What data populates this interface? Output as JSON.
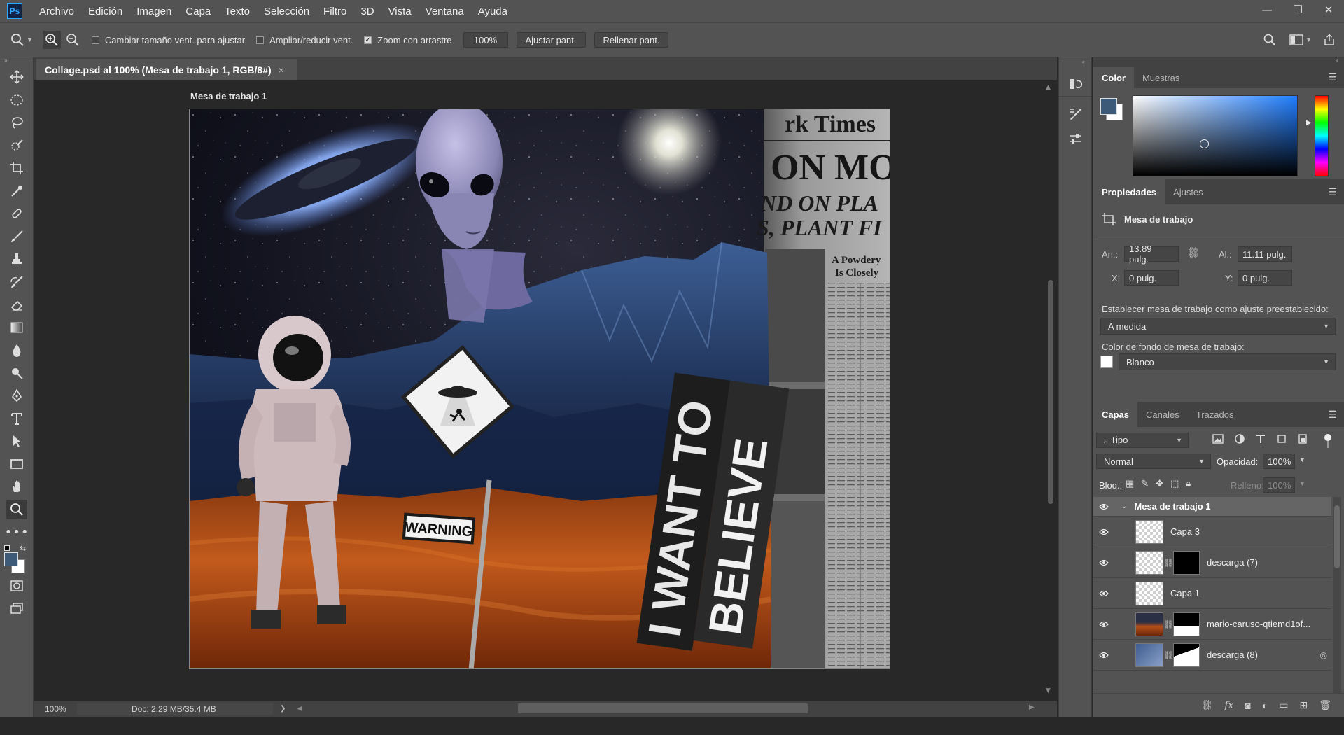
{
  "menu": {
    "logo": "Ps",
    "items": [
      "Archivo",
      "Edición",
      "Imagen",
      "Capa",
      "Texto",
      "Selección",
      "Filtro",
      "3D",
      "Vista",
      "Ventana",
      "Ayuda"
    ]
  },
  "window_controls": {
    "minimize": "—",
    "restore": "❐",
    "close": "✕"
  },
  "options_bar": {
    "resize_windows_label": "Cambiar tamaño vent. para ajustar",
    "resize_windows_checked": false,
    "zoom_all_label": "Ampliar/reducir vent.",
    "zoom_all_checked": false,
    "scrubby_zoom_label": "Zoom con arrastre",
    "scrubby_zoom_checked": true,
    "zoom_value": "100%",
    "fit_screen_label": "Ajustar pant.",
    "fill_screen_label": "Rellenar pant."
  },
  "document": {
    "tab_title": "Collage.psd al 100% (Mesa de trabajo 1, RGB/8#)",
    "tab_close": "×",
    "artboard_label": "Mesa de trabajo 1",
    "collage_texts": {
      "newspaper_masthead": "rk Times",
      "newspaper_headline": "ON MOO",
      "newspaper_sub1": "ND ON PLA",
      "newspaper_sub2": "S, PLANT FI",
      "newspaper_small1": "A Powdery",
      "newspaper_small2": "Is Closely",
      "warning_sign": "WARNING",
      "slogan_line1": "I WANT TO",
      "slogan_line2": "BELIEVE"
    }
  },
  "status_bar": {
    "zoom": "100%",
    "doc_info": "Doc: 2.29 MB/35.4 MB",
    "arrow": "❯"
  },
  "color_panel": {
    "tabs": [
      "Color",
      "Muestras"
    ],
    "active_tab": "Color",
    "foreground_color": "#3d5a78",
    "background_color": "#ffffff"
  },
  "properties_panel": {
    "tabs": [
      "Propiedades",
      "Ajustes"
    ],
    "active_tab": "Propiedades",
    "section_title": "Mesa de trabajo",
    "width_label": "An.:",
    "width_value": "13.89 pulg.",
    "height_label": "Al.:",
    "height_value": "11.11 pulg.",
    "x_label": "X:",
    "x_value": "0 pulg.",
    "y_label": "Y:",
    "y_value": "0 pulg.",
    "preset_label": "Establecer mesa de trabajo como ajuste preestablecido:",
    "preset_value": "A medida",
    "bg_label": "Color de fondo de mesa de trabajo:",
    "bg_value": "Blanco"
  },
  "layers_panel": {
    "tabs": [
      "Capas",
      "Canales",
      "Trazados"
    ],
    "active_tab": "Capas",
    "filter_kind": "Tipo",
    "blend_mode": "Normal",
    "opacity_label": "Opacidad:",
    "opacity_value": "100%",
    "lock_label": "Bloq.:",
    "fill_label": "Relleno:",
    "fill_value": "100%",
    "group_name": "Mesa de trabajo 1",
    "layers": [
      {
        "name": "Capa 3",
        "has_mask": false
      },
      {
        "name": "descarga (7)",
        "has_mask": true
      },
      {
        "name": "Capa 1",
        "has_mask": false
      },
      {
        "name": "mario-caruso-qtiemd1of...",
        "has_mask": true
      },
      {
        "name": "descarga (8)",
        "has_mask": true
      }
    ]
  }
}
